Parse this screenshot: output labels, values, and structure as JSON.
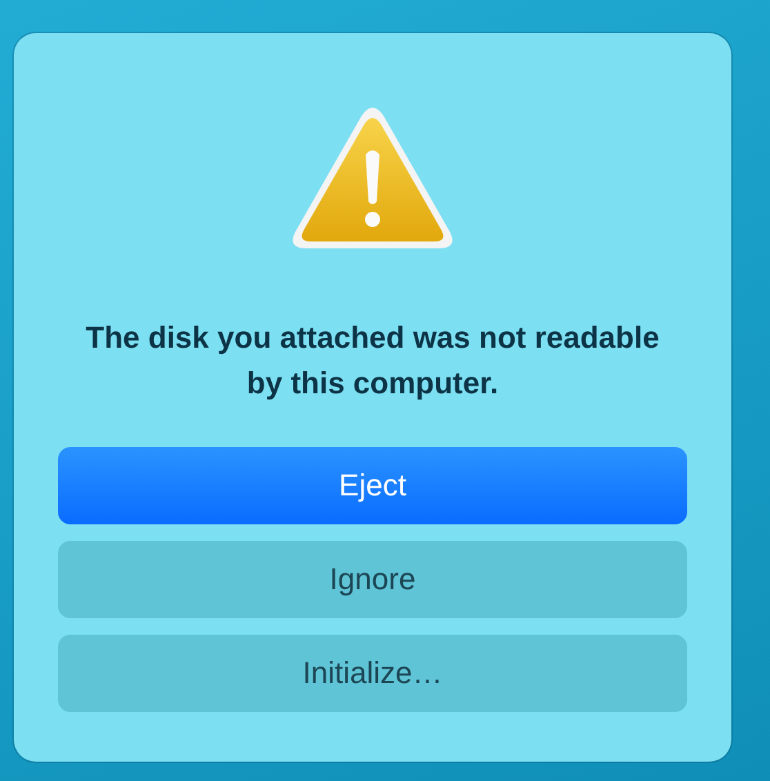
{
  "alert": {
    "message": "The disk you attached was not readable by this computer.",
    "buttons": [
      {
        "label": "Eject",
        "default": true
      },
      {
        "label": "Ignore",
        "default": false
      },
      {
        "label": "Initialize…",
        "default": false
      }
    ]
  }
}
